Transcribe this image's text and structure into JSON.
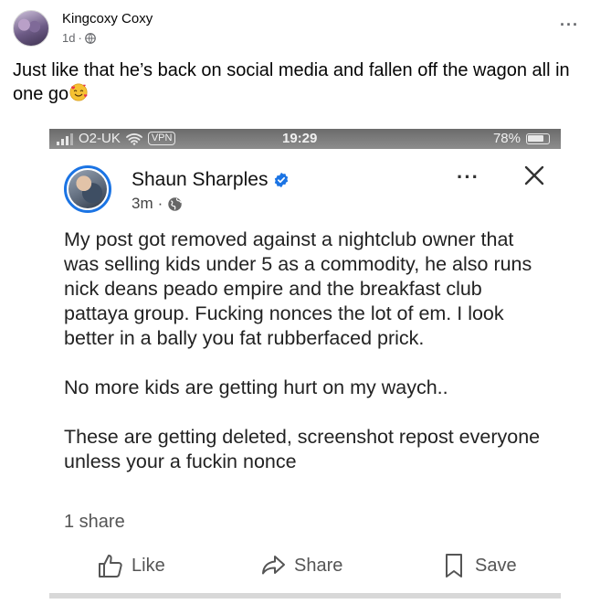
{
  "outer_post": {
    "author": "Kingcoxy Coxy",
    "time": "1d",
    "separator": "·",
    "more_label": "···",
    "text": "Just like that he’s back on social media and fallen off the wagon all in one go"
  },
  "screenshot": {
    "status_bar": {
      "carrier": "O2-UK",
      "vpn": "VPN",
      "time": "19:29",
      "battery": "78%"
    },
    "post": {
      "author": "Shaun Sharples",
      "time": "3m",
      "separator": "·",
      "more_label": "···",
      "paragraphs": [
        "My post got removed against a nightclub owner that was selling kids under 5 as a commodity, he also runs nick deans peado empire and the breakfast club pattaya group. Fucking nonces the lot of em. I look better in a bally you fat rubberfaced prick.",
        "No more kids are getting hurt on my waych..",
        "These are getting deleted, screenshot repost everyone unless your a fuckin nonce"
      ],
      "share_count": "1 share"
    },
    "actions": {
      "like": "Like",
      "share": "Share",
      "save": "Save"
    }
  },
  "colors": {
    "text_primary": "#050505",
    "text_secondary": "#65676b",
    "verified_blue": "#1b74e4",
    "status_bar": "#7a7a7a"
  }
}
